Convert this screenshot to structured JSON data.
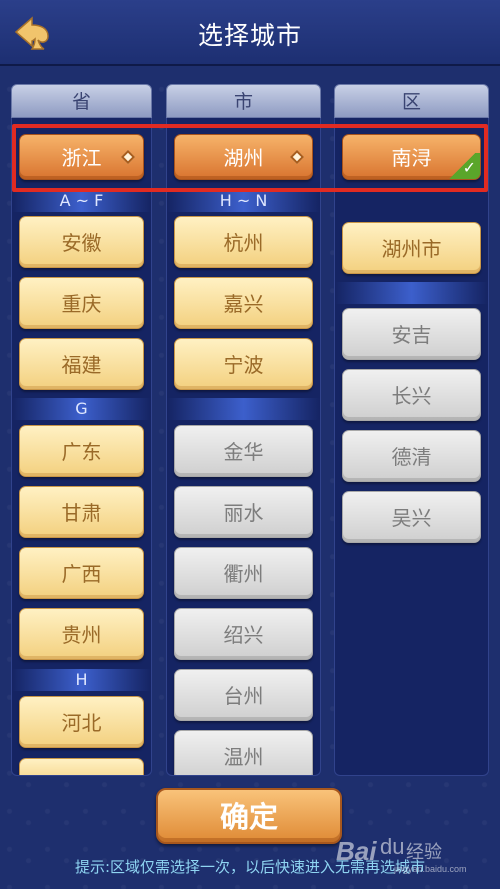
{
  "header": {
    "title": "选择城市",
    "back_icon": "spade-back-icon"
  },
  "columns": {
    "province": {
      "header": "省",
      "selected": "浙江"
    },
    "city": {
      "header": "市",
      "selected": "湖州"
    },
    "district": {
      "header": "区",
      "selected": "南浔"
    }
  },
  "province_list": {
    "groups": [
      "A ~ F",
      "G",
      "H"
    ],
    "items": [
      "安徽",
      "重庆",
      "福建",
      "广东",
      "甘肃",
      "广西",
      "贵州",
      "河北"
    ]
  },
  "city_list": {
    "groups": [
      "H ~ N"
    ],
    "available": [
      "杭州",
      "嘉兴",
      "宁波"
    ],
    "unavailable": [
      "金华",
      "丽水",
      "衢州",
      "绍兴",
      "台州",
      "温州"
    ]
  },
  "district_list": {
    "available": [
      "湖州市"
    ],
    "unavailable": [
      "安吉",
      "长兴",
      "德清",
      "吴兴"
    ]
  },
  "confirm_label": "确定",
  "hint": "提示:区域仅需选择一次，以后快速进入无需再选城市",
  "watermark": {
    "logo": "Bai",
    "paw": "du",
    "text": "经验",
    "url": "jingyan.baidu.com"
  },
  "colors": {
    "background": "#1e2f6e",
    "selected": "#e3803a",
    "available": "#f6dc98",
    "unavailable": "#dcdcdc",
    "highlight": "#e12b22",
    "check": "#5aa62a",
    "hint": "#8fd5f2"
  }
}
